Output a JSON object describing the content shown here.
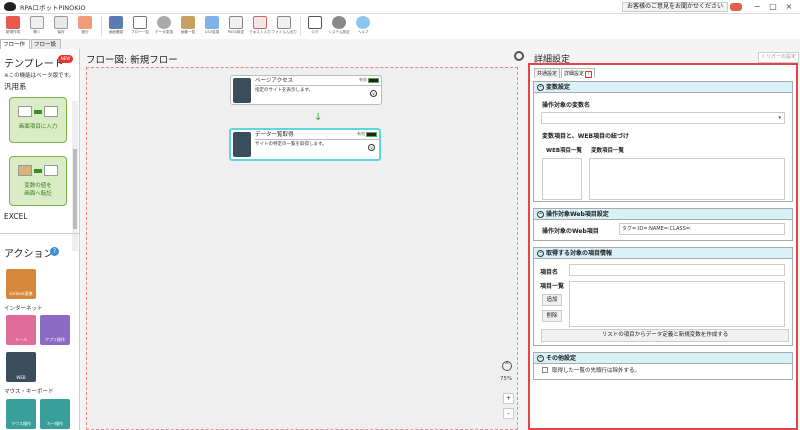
{
  "window": {
    "title": "RPAロボットPINOKIO",
    "feedback": "お客様のご意見をお聞かせください",
    "minimize": "−",
    "maximize": "□",
    "close": "×"
  },
  "toolbar": [
    "新規作成",
    "開く",
    "保存",
    "実行",
    "画面確認",
    "フロー一覧",
    "データ変換",
    "画像一覧",
    "CSV変換",
    "PASS設定",
    "テキスト入力",
    "ファイル入出力",
    "ログ",
    "システム設定",
    "ヘルプ"
  ],
  "left_tabs": [
    "フロー作成",
    "フロー設定"
  ],
  "template": {
    "heading": "テンプレート",
    "badge": "NEW",
    "note": "※この機能はベータ版です。",
    "cat1": "汎用系",
    "cards": [
      "画面項目に入力",
      "変数の値を\n画面へ転記"
    ],
    "cat2": "EXCEL"
  },
  "actions": {
    "heading": "アクション",
    "help": "?",
    "first": "kintone連携",
    "cat_internet": "インターネット",
    "internet": [
      "メール",
      "アプリ操作",
      "WEB"
    ],
    "cat_mouse": "マウス・キーボード",
    "mouse": [
      "マウス操作",
      "キー操作"
    ]
  },
  "canvas": {
    "title": "フロー図: 新規フロー",
    "node1": {
      "title": "ページアクセス",
      "desc": "指定のサイトを表示します。",
      "status": "有効"
    },
    "node2": {
      "title": "データ一覧取得",
      "desc": "サイトの特定の一覧を取得します。",
      "status": "有効",
      "warn": "!"
    },
    "arrow": "↓",
    "zoom": "75%",
    "zoom_in": "+",
    "zoom_out": "-",
    "zoom_toggle": "^"
  },
  "detail": {
    "title": "詳細設定",
    "trigger": "トリガーの設定",
    "tabs": [
      "共通設定",
      "詳細設定"
    ],
    "tab_warn": "!",
    "s1": {
      "title": "変数設定",
      "label1": "操作対象の変数名",
      "label2": "変数項目と、WEB項目の紐づけ",
      "col1": "WEB項目一覧",
      "col2": "変数項目一覧",
      "select_arrow": "▾"
    },
    "s2": {
      "title": "操作対象Web項目設定",
      "label": "操作対象のWeb項目",
      "value": "タグ=:ID=:NAME=:CLASS=:"
    },
    "s3": {
      "title": "取得する対象の項目情報",
      "name_label": "項目名",
      "list_label": "項目一覧",
      "add": "追加",
      "del": "削除",
      "create": "リストの項目からデータ定義と新規変数を作成する"
    },
    "s4": {
      "title": "その他設定",
      "check": "取得した一覧の先頭行は除外する。"
    },
    "toggle": "^"
  }
}
